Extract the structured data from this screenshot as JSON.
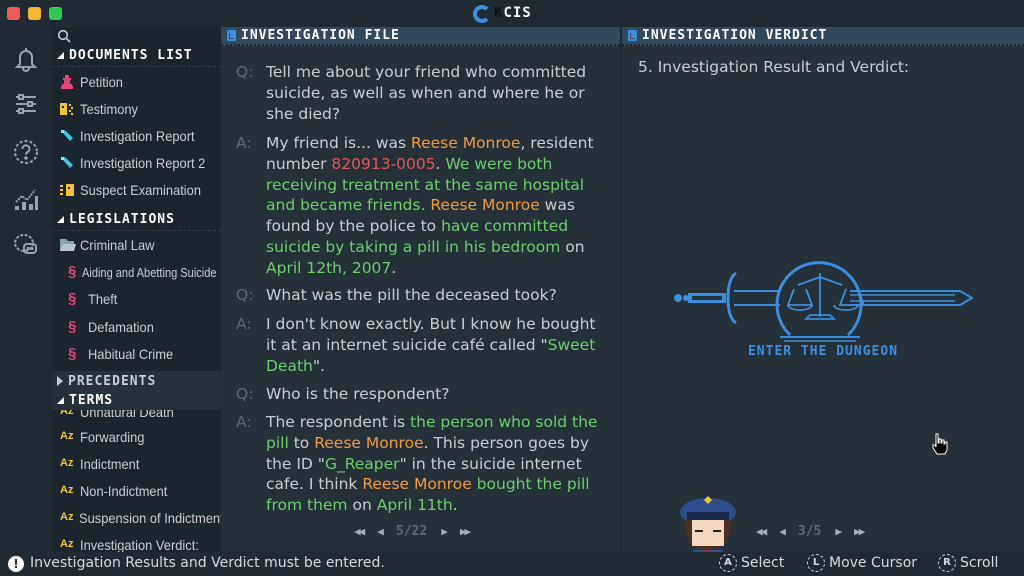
{
  "window": {
    "app_title_prefix": "K",
    "app_title": "CIS"
  },
  "rail": {
    "icons": [
      "bell-icon",
      "sliders-icon",
      "help-icon",
      "stats-icon",
      "chat-icon"
    ]
  },
  "sidebar": {
    "sections": {
      "documents": {
        "label": "DOCUMENTS LIST",
        "items": [
          {
            "label": "Petition",
            "icon": "petition-icon"
          },
          {
            "label": "Testimony",
            "icon": "testimony-icon"
          },
          {
            "label": "Investigation Report",
            "icon": "flashlight-icon"
          },
          {
            "label": "Investigation Report 2",
            "icon": "flashlight-icon"
          },
          {
            "label": "Suspect Examination",
            "icon": "examination-icon"
          }
        ]
      },
      "legislations": {
        "label": "LEGISLATIONS",
        "folder": "Criminal Law",
        "items": [
          {
            "label": "Aiding and Abetting Suicide"
          },
          {
            "label": "Theft"
          },
          {
            "label": "Defamation"
          },
          {
            "label": "Habitual Crime"
          }
        ]
      },
      "precedents": {
        "label": "PRECEDENTS"
      },
      "terms": {
        "label": "TERMS",
        "items": [
          {
            "label": "Unnatural Death"
          },
          {
            "label": "Forwarding"
          },
          {
            "label": "Indictment"
          },
          {
            "label": "Non-Indictment"
          },
          {
            "label": "Suspension of Indictment:"
          },
          {
            "label": "Investigation Verdict:"
          }
        ]
      }
    }
  },
  "investigation_file": {
    "title": "INVESTIGATION FILE",
    "q_tag": "Q:",
    "a_tag": "A:",
    "entries": [
      {
        "type": "Q",
        "segments": [
          {
            "t": "Tell me about your friend who committed suicide, as well as when and where he or she died?",
            "c": ""
          }
        ]
      },
      {
        "type": "A",
        "segments": [
          {
            "t": "My friend is... was ",
            "c": ""
          },
          {
            "t": "Reese Monroe",
            "c": "orange"
          },
          {
            "t": ", resident number ",
            "c": ""
          },
          {
            "t": "820913-0005",
            "c": "red"
          },
          {
            "t": ". ",
            "c": ""
          },
          {
            "t": "We were both receiving treatment at the same hospital and became friends.",
            "c": "green"
          },
          {
            "t": " ",
            "c": ""
          },
          {
            "t": "Reese Monroe",
            "c": "orange"
          },
          {
            "t": " was found by the police to ",
            "c": ""
          },
          {
            "t": "have committed suicide by taking a pill in his bedroom",
            "c": "green"
          },
          {
            "t": " on ",
            "c": ""
          },
          {
            "t": "April 12th, 2007",
            "c": "green"
          },
          {
            "t": ".",
            "c": ""
          }
        ]
      },
      {
        "type": "Q",
        "segments": [
          {
            "t": "What was the pill the deceased took?",
            "c": ""
          }
        ]
      },
      {
        "type": "A",
        "segments": [
          {
            "t": "I don't know exactly. But I know he bought it at an internet suicide café called \"",
            "c": ""
          },
          {
            "t": "Sweet Death",
            "c": "green"
          },
          {
            "t": "\".",
            "c": ""
          }
        ]
      },
      {
        "type": "Q",
        "segments": [
          {
            "t": "Who is the respondent?",
            "c": ""
          }
        ]
      },
      {
        "type": "A",
        "segments": [
          {
            "t": "The respondent is ",
            "c": ""
          },
          {
            "t": "the person who sold the pill",
            "c": "green"
          },
          {
            "t": " to ",
            "c": ""
          },
          {
            "t": "Reese Monroe",
            "c": "orange"
          },
          {
            "t": ". This person goes by the ID \"",
            "c": ""
          },
          {
            "t": "G_Reaper",
            "c": "green"
          },
          {
            "t": "\" in the suicide internet cafe. I think ",
            "c": ""
          },
          {
            "t": "Reese Monroe",
            "c": "orange"
          },
          {
            "t": " ",
            "c": ""
          },
          {
            "t": "bought the pill from them",
            "c": "green"
          },
          {
            "t": " on ",
            "c": ""
          },
          {
            "t": "April 11th",
            "c": "green"
          },
          {
            "t": ".",
            "c": ""
          }
        ]
      }
    ],
    "pager": {
      "current": 5,
      "total": 22,
      "label": "5/22"
    }
  },
  "investigation_verdict": {
    "title": "INVESTIGATION VERDICT",
    "heading": "5. Investigation Result and Verdict:",
    "emblem_text": "ENTER THE DUNGEON",
    "pager": {
      "current": 3,
      "total": 5,
      "label": "3/5"
    }
  },
  "footer": {
    "warning": "Investigation Results and Verdict must be entered.",
    "hints": [
      {
        "key": "A",
        "label": "Select"
      },
      {
        "key": "L",
        "label": "Move Cursor"
      },
      {
        "key": "R",
        "label": "Scroll"
      }
    ]
  },
  "colors": {
    "accent_blue": "#3a8fe0",
    "highlight_orange": "#f09a3e",
    "highlight_red": "#e05a5a",
    "highlight_green": "#6ccf6a",
    "pink": "#e0457b",
    "yellow": "#f2c530",
    "cyan": "#3cc6d8"
  }
}
